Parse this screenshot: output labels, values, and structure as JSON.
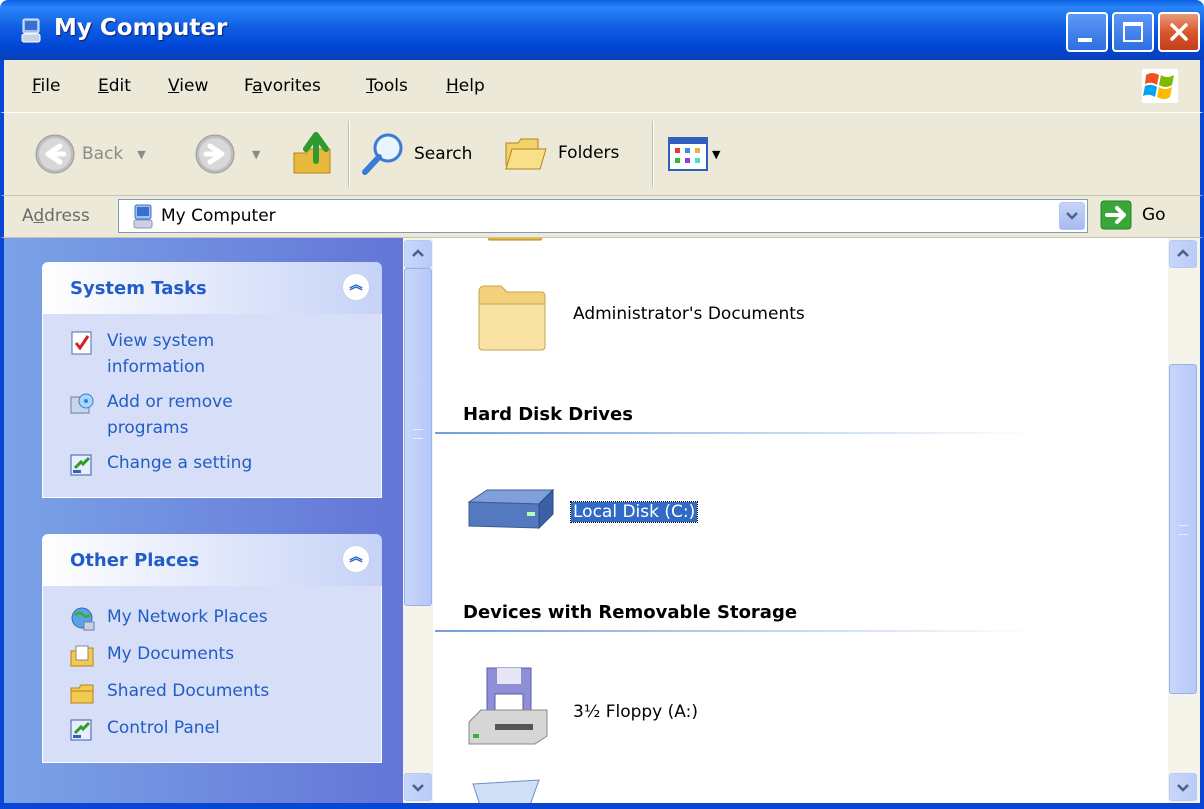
{
  "window": {
    "title": "My Computer"
  },
  "menu": [
    {
      "label": "File",
      "accel": "F",
      "rest": "ile"
    },
    {
      "label": "Edit",
      "accel": "E",
      "rest": "dit"
    },
    {
      "label": "View",
      "accel": "V",
      "rest": "iew"
    },
    {
      "label": "Favorites",
      "pre": "F",
      "accel": "a",
      "rest": "vorites"
    },
    {
      "label": "Tools",
      "accel": "T",
      "rest": "ools"
    },
    {
      "label": "Help",
      "accel": "H",
      "rest": "elp"
    }
  ],
  "toolbar": {
    "back_label": "Back",
    "search_label": "Search",
    "folders_label": "Folders"
  },
  "address": {
    "label_pre": "A",
    "label_accel": "d",
    "label_rest": "dress",
    "value": "My Computer",
    "go_label": "Go"
  },
  "taskpane": {
    "system_tasks": {
      "title": "System Tasks",
      "items": [
        {
          "line1": "View system",
          "line2": "information",
          "icon": "system-info-icon"
        },
        {
          "line1": "Add or remove",
          "line2": "programs",
          "icon": "add-remove-programs-icon"
        },
        {
          "line1": "Change a setting",
          "line2": "",
          "icon": "control-panel-icon"
        }
      ]
    },
    "other_places": {
      "title": "Other Places",
      "items": [
        {
          "label": "My Network Places",
          "icon": "network-places-icon"
        },
        {
          "label": "My Documents",
          "icon": "my-documents-icon"
        },
        {
          "label": "Shared Documents",
          "icon": "shared-documents-icon"
        },
        {
          "label": "Control Panel",
          "icon": "control-panel-icon"
        }
      ]
    }
  },
  "content": {
    "folder_item": "Administrator's Documents",
    "groups": {
      "hard_disk": {
        "title": "Hard Disk Drives",
        "items": [
          {
            "label": "Local Disk (C:)",
            "selected": true
          }
        ]
      },
      "removable": {
        "title": "Devices with Removable Storage",
        "items": [
          {
            "label": "3½ Floppy (A:)"
          }
        ]
      }
    }
  },
  "colors": {
    "titlebar": "#0a5fe0",
    "taskpane_bg": "#6f8fdc",
    "link": "#215dc6",
    "selection": "#316ac5"
  }
}
